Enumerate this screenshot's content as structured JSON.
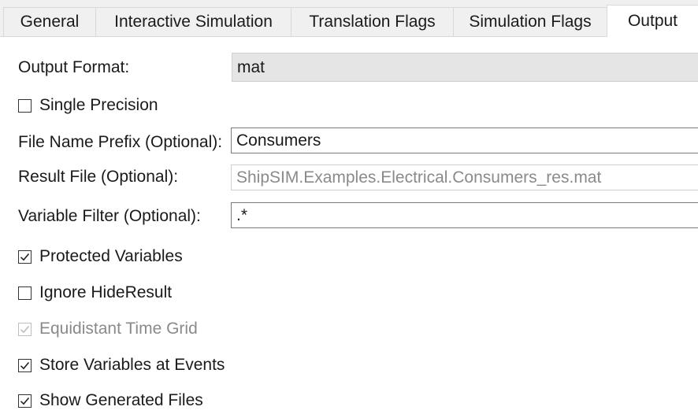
{
  "tabs": [
    {
      "label": "General",
      "active": false
    },
    {
      "label": "Interactive Simulation",
      "active": false
    },
    {
      "label": "Translation Flags",
      "active": false
    },
    {
      "label": "Simulation Flags",
      "active": false
    },
    {
      "label": "Output",
      "active": true
    }
  ],
  "output_format": {
    "label": "Output Format:",
    "value": "mat"
  },
  "single_precision": {
    "label": "Single Precision",
    "checked": false
  },
  "file_name_prefix": {
    "label": "File Name Prefix (Optional):",
    "value": "Consumers"
  },
  "result_file": {
    "label": "Result File (Optional):",
    "value": "ShipSIM.Examples.Electrical.Consumers_res.mat"
  },
  "variable_filter": {
    "label": "Variable Filter (Optional):",
    "value": ".*"
  },
  "protected_variables": {
    "label": "Protected Variables",
    "checked": true
  },
  "ignore_hide_result": {
    "label": "Ignore HideResult",
    "checked": false
  },
  "equidistant_time_grid": {
    "label": "Equidistant Time Grid",
    "checked": true,
    "disabled": true
  },
  "store_variables_at_events": {
    "label": "Store Variables at Events",
    "checked": true
  },
  "show_generated_files": {
    "label": "Show Generated Files",
    "checked": true
  }
}
